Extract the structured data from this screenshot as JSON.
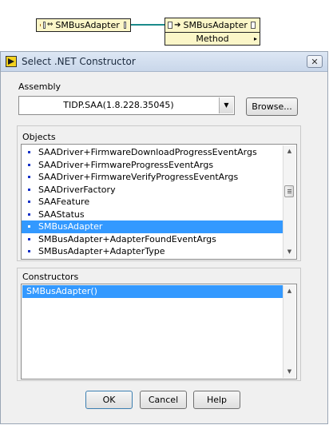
{
  "diagram": {
    "adapter_node_label": "SMBusAdapter",
    "invoke_node_label": "SMBusAdapter",
    "invoke_method_label": "Method",
    "wire_color": "#1a8b8b",
    "node_color": "#fbf6c8"
  },
  "dialog": {
    "title": "Select .NET Constructor",
    "close_label": "✕",
    "assembly": {
      "label": "Assembly",
      "selected": "TIDP.SAA(1.8.228.35045)",
      "browse_label": "Browse..."
    },
    "objects": {
      "label": "Objects",
      "items": [
        "SAADriver+FirmwareDownloadProgressEventArgs",
        "SAADriver+FirmwareProgressEventArgs",
        "SAADriver+FirmwareVerifyProgressEventArgs",
        "SAADriverFactory",
        "SAAFeature",
        "SAAStatus",
        "SMBusAdapter",
        "SMBusAdapter+AdapterFoundEventArgs",
        "SMBusAdapter+AdapterType"
      ],
      "selected": "SMBusAdapter"
    },
    "constructors": {
      "label": "Constructors",
      "items": [
        "SMBusAdapter()"
      ],
      "selected": "SMBusAdapter()"
    },
    "buttons": {
      "ok": "OK",
      "cancel": "Cancel",
      "help": "Help"
    }
  },
  "colors": {
    "selection": "#3399ff",
    "dialog_bg": "#f0f0f0"
  }
}
